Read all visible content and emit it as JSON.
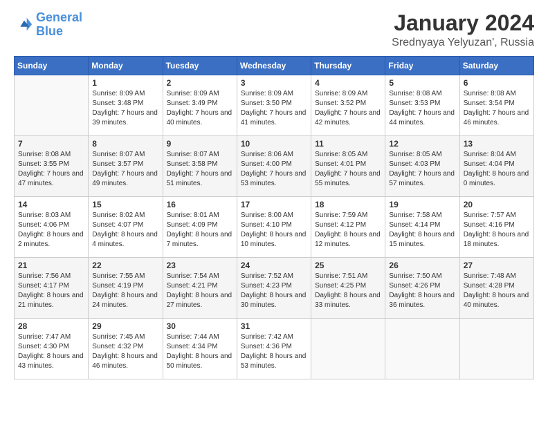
{
  "header": {
    "logo_line1": "General",
    "logo_line2": "Blue",
    "main_title": "January 2024",
    "subtitle": "Srednyaya Yelyuzan', Russia"
  },
  "calendar": {
    "days_of_week": [
      "Sunday",
      "Monday",
      "Tuesday",
      "Wednesday",
      "Thursday",
      "Friday",
      "Saturday"
    ],
    "weeks": [
      [
        {
          "day": "",
          "sunrise": "",
          "sunset": "",
          "daylight": ""
        },
        {
          "day": "1",
          "sunrise": "Sunrise: 8:09 AM",
          "sunset": "Sunset: 3:48 PM",
          "daylight": "Daylight: 7 hours and 39 minutes."
        },
        {
          "day": "2",
          "sunrise": "Sunrise: 8:09 AM",
          "sunset": "Sunset: 3:49 PM",
          "daylight": "Daylight: 7 hours and 40 minutes."
        },
        {
          "day": "3",
          "sunrise": "Sunrise: 8:09 AM",
          "sunset": "Sunset: 3:50 PM",
          "daylight": "Daylight: 7 hours and 41 minutes."
        },
        {
          "day": "4",
          "sunrise": "Sunrise: 8:09 AM",
          "sunset": "Sunset: 3:52 PM",
          "daylight": "Daylight: 7 hours and 42 minutes."
        },
        {
          "day": "5",
          "sunrise": "Sunrise: 8:08 AM",
          "sunset": "Sunset: 3:53 PM",
          "daylight": "Daylight: 7 hours and 44 minutes."
        },
        {
          "day": "6",
          "sunrise": "Sunrise: 8:08 AM",
          "sunset": "Sunset: 3:54 PM",
          "daylight": "Daylight: 7 hours and 46 minutes."
        }
      ],
      [
        {
          "day": "7",
          "sunrise": "Sunrise: 8:08 AM",
          "sunset": "Sunset: 3:55 PM",
          "daylight": "Daylight: 7 hours and 47 minutes."
        },
        {
          "day": "8",
          "sunrise": "Sunrise: 8:07 AM",
          "sunset": "Sunset: 3:57 PM",
          "daylight": "Daylight: 7 hours and 49 minutes."
        },
        {
          "day": "9",
          "sunrise": "Sunrise: 8:07 AM",
          "sunset": "Sunset: 3:58 PM",
          "daylight": "Daylight: 7 hours and 51 minutes."
        },
        {
          "day": "10",
          "sunrise": "Sunrise: 8:06 AM",
          "sunset": "Sunset: 4:00 PM",
          "daylight": "Daylight: 7 hours and 53 minutes."
        },
        {
          "day": "11",
          "sunrise": "Sunrise: 8:05 AM",
          "sunset": "Sunset: 4:01 PM",
          "daylight": "Daylight: 7 hours and 55 minutes."
        },
        {
          "day": "12",
          "sunrise": "Sunrise: 8:05 AM",
          "sunset": "Sunset: 4:03 PM",
          "daylight": "Daylight: 7 hours and 57 minutes."
        },
        {
          "day": "13",
          "sunrise": "Sunrise: 8:04 AM",
          "sunset": "Sunset: 4:04 PM",
          "daylight": "Daylight: 8 hours and 0 minutes."
        }
      ],
      [
        {
          "day": "14",
          "sunrise": "Sunrise: 8:03 AM",
          "sunset": "Sunset: 4:06 PM",
          "daylight": "Daylight: 8 hours and 2 minutes."
        },
        {
          "day": "15",
          "sunrise": "Sunrise: 8:02 AM",
          "sunset": "Sunset: 4:07 PM",
          "daylight": "Daylight: 8 hours and 4 minutes."
        },
        {
          "day": "16",
          "sunrise": "Sunrise: 8:01 AM",
          "sunset": "Sunset: 4:09 PM",
          "daylight": "Daylight: 8 hours and 7 minutes."
        },
        {
          "day": "17",
          "sunrise": "Sunrise: 8:00 AM",
          "sunset": "Sunset: 4:10 PM",
          "daylight": "Daylight: 8 hours and 10 minutes."
        },
        {
          "day": "18",
          "sunrise": "Sunrise: 7:59 AM",
          "sunset": "Sunset: 4:12 PM",
          "daylight": "Daylight: 8 hours and 12 minutes."
        },
        {
          "day": "19",
          "sunrise": "Sunrise: 7:58 AM",
          "sunset": "Sunset: 4:14 PM",
          "daylight": "Daylight: 8 hours and 15 minutes."
        },
        {
          "day": "20",
          "sunrise": "Sunrise: 7:57 AM",
          "sunset": "Sunset: 4:16 PM",
          "daylight": "Daylight: 8 hours and 18 minutes."
        }
      ],
      [
        {
          "day": "21",
          "sunrise": "Sunrise: 7:56 AM",
          "sunset": "Sunset: 4:17 PM",
          "daylight": "Daylight: 8 hours and 21 minutes."
        },
        {
          "day": "22",
          "sunrise": "Sunrise: 7:55 AM",
          "sunset": "Sunset: 4:19 PM",
          "daylight": "Daylight: 8 hours and 24 minutes."
        },
        {
          "day": "23",
          "sunrise": "Sunrise: 7:54 AM",
          "sunset": "Sunset: 4:21 PM",
          "daylight": "Daylight: 8 hours and 27 minutes."
        },
        {
          "day": "24",
          "sunrise": "Sunrise: 7:52 AM",
          "sunset": "Sunset: 4:23 PM",
          "daylight": "Daylight: 8 hours and 30 minutes."
        },
        {
          "day": "25",
          "sunrise": "Sunrise: 7:51 AM",
          "sunset": "Sunset: 4:25 PM",
          "daylight": "Daylight: 8 hours and 33 minutes."
        },
        {
          "day": "26",
          "sunrise": "Sunrise: 7:50 AM",
          "sunset": "Sunset: 4:26 PM",
          "daylight": "Daylight: 8 hours and 36 minutes."
        },
        {
          "day": "27",
          "sunrise": "Sunrise: 7:48 AM",
          "sunset": "Sunset: 4:28 PM",
          "daylight": "Daylight: 8 hours and 40 minutes."
        }
      ],
      [
        {
          "day": "28",
          "sunrise": "Sunrise: 7:47 AM",
          "sunset": "Sunset: 4:30 PM",
          "daylight": "Daylight: 8 hours and 43 minutes."
        },
        {
          "day": "29",
          "sunrise": "Sunrise: 7:45 AM",
          "sunset": "Sunset: 4:32 PM",
          "daylight": "Daylight: 8 hours and 46 minutes."
        },
        {
          "day": "30",
          "sunrise": "Sunrise: 7:44 AM",
          "sunset": "Sunset: 4:34 PM",
          "daylight": "Daylight: 8 hours and 50 minutes."
        },
        {
          "day": "31",
          "sunrise": "Sunrise: 7:42 AM",
          "sunset": "Sunset: 4:36 PM",
          "daylight": "Daylight: 8 hours and 53 minutes."
        },
        {
          "day": "",
          "sunrise": "",
          "sunset": "",
          "daylight": ""
        },
        {
          "day": "",
          "sunrise": "",
          "sunset": "",
          "daylight": ""
        },
        {
          "day": "",
          "sunrise": "",
          "sunset": "",
          "daylight": ""
        }
      ]
    ]
  }
}
